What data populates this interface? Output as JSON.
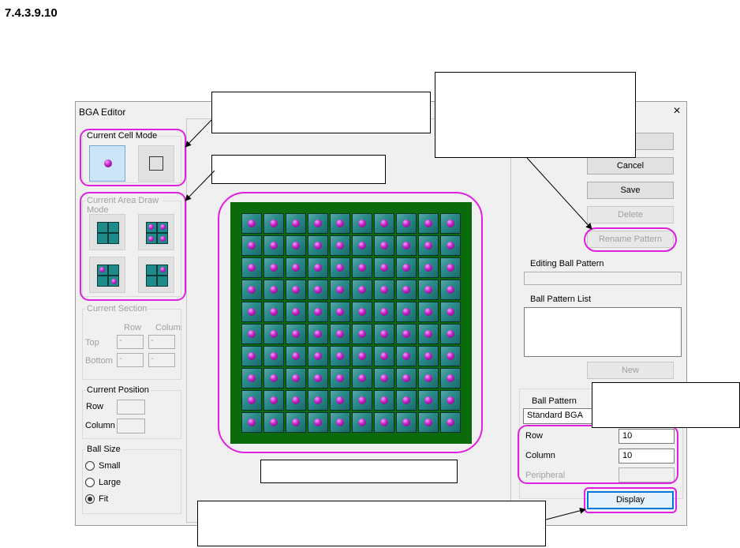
{
  "heading": "7.4.3.9.10",
  "window": {
    "title": "BGA Editor",
    "close_glyph": "×"
  },
  "cell_mode": {
    "legend": "Current Cell Mode",
    "icons": [
      "ball-cell-icon",
      "empty-cell-icon"
    ]
  },
  "area_mode": {
    "legend": "Current Area Draw Mode",
    "icons": [
      "area-empty-icon",
      "area-all-balls-icon",
      "area-diagonal-icon",
      "area-corner-icon"
    ]
  },
  "section": {
    "legend": "Current Section",
    "col_row": "Row",
    "col_column": "Column",
    "top_label": "Top",
    "bottom_label": "Bottom",
    "top_row": "-",
    "top_col": "-",
    "bottom_row": "-",
    "bottom_col": "-"
  },
  "position": {
    "legend": "Current Position",
    "row_label": "Row",
    "column_label": "Column",
    "row_value": "",
    "column_value": ""
  },
  "ball_size": {
    "legend": "Ball Size",
    "options": [
      {
        "label": "Small",
        "checked": false
      },
      {
        "label": "Large",
        "checked": false
      },
      {
        "label": "Fit",
        "checked": true
      }
    ]
  },
  "grid": {
    "rows": 10,
    "columns": 10,
    "ball_color": "#c020c0",
    "cell_color": "#2a8c8c",
    "board_color": "#0b6a0b"
  },
  "buttons": {
    "ok": "",
    "cancel": "Cancel",
    "save": "Save",
    "delete": "Delete",
    "rename": "Rename Pattern",
    "new": "New",
    "display": "Display"
  },
  "editing_pattern": {
    "label": "Editing Ball Pattern",
    "value": ""
  },
  "pattern_list": {
    "label": "Ball Pattern List",
    "items": []
  },
  "ball_pattern": {
    "label": "Ball Pattern",
    "selected": "Standard BGA",
    "row_label": "Row",
    "row_value": "10",
    "column_label": "Column",
    "column_value": "10",
    "peripheral_label": "Peripheral",
    "peripheral_value": ""
  },
  "highlight_color": "#e020e0"
}
